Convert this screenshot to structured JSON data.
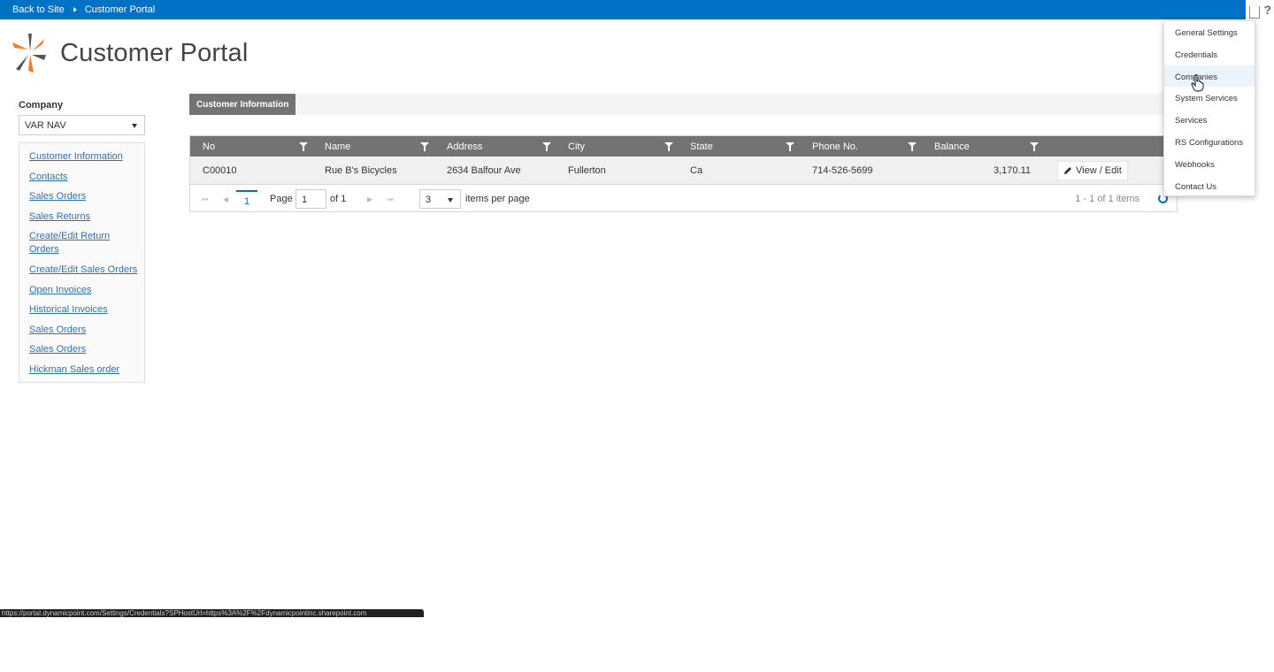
{
  "topbar": {
    "back_link": "Back to Site",
    "current": "Customer Portal",
    "help": "?"
  },
  "header": {
    "title": "Customer Portal"
  },
  "company": {
    "label": "Company",
    "selected": "VAR NAV"
  },
  "sidebar": {
    "items": [
      "Customer Information",
      "Contacts",
      "Sales Orders",
      "Sales Returns",
      "Create/Edit Return Orders",
      "Create/Edit Sales Orders",
      "Open Invoices",
      "Historical Invoices",
      "Sales Orders",
      "Sales Orders",
      "Hickman Sales order"
    ]
  },
  "tabs": {
    "active": "Customer Information"
  },
  "grid": {
    "columns": [
      "No",
      "Name",
      "Address",
      "City",
      "State",
      "Phone No.",
      "Balance"
    ],
    "rows": [
      {
        "no": "C00010",
        "name": "Rue B's Bicycles",
        "address": "2634 Balfour Ave",
        "city": "Fullerton",
        "state": "Ca",
        "phone": "714-526-5699",
        "balance": "3,170.11",
        "action": "View / Edit"
      }
    ]
  },
  "pager": {
    "current_page": "1",
    "page_label": "Page",
    "page_input": "1",
    "of_label": "of 1",
    "page_size": "3",
    "items_per_page": "items per page",
    "info": "1 - 1 of 1 items"
  },
  "settings_menu": {
    "items": [
      "General Settings",
      "Credentials",
      "Companies",
      "System Services",
      "Services",
      "RS Configurations",
      "Webhooks",
      "Contact Us"
    ],
    "hovered": "Companies"
  },
  "status_bar": {
    "url": "https://portal.dynamicpoint.com/Settings/Credentials?SPHostUrl=https%3A%2F%2Fdynamicpointinc.sharepoint.com"
  },
  "colors": {
    "suite_bar": "#0072c6",
    "grid_header": "#737373",
    "link": "#2f6fb6",
    "logo_orange": "#f47b20"
  }
}
